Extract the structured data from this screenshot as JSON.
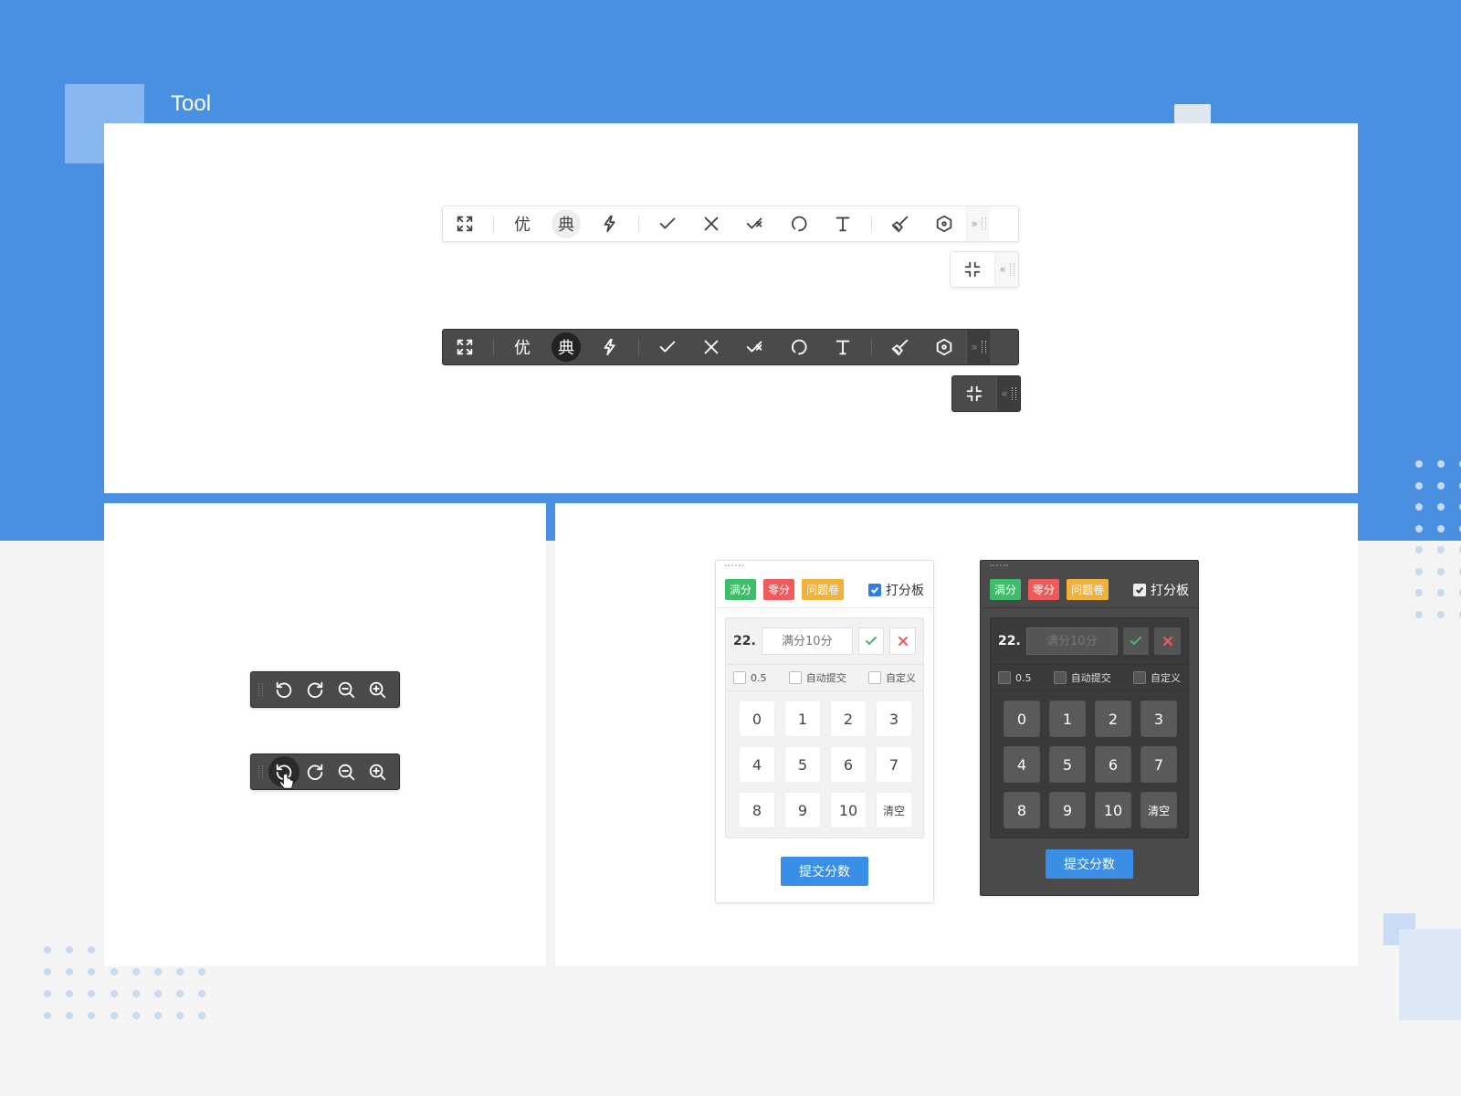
{
  "page": {
    "title": "Tool"
  },
  "toolbar": {
    "label_you": "优",
    "label_dian": "典",
    "collapse_more": "»",
    "collapse_less": "«"
  },
  "scoreboard": {
    "tags": {
      "full": "满分",
      "zero": "零分",
      "problem": "问题卷"
    },
    "panel_toggle": "打分板",
    "question_no": "22.",
    "placeholder": "满分10分",
    "options": {
      "half": "0.5",
      "auto_submit": "自动提交",
      "custom": "自定义"
    },
    "keys": [
      "0",
      "1",
      "2",
      "3",
      "4",
      "5",
      "6",
      "7",
      "8",
      "9",
      "10",
      "清空"
    ],
    "submit": "提交分数"
  },
  "colors": {
    "primary_blue": "#4a90e2",
    "button_blue": "#3a8ee6",
    "tag_green": "#3ebd6a",
    "tag_red": "#f05a5a",
    "tag_yellow": "#f2b13a"
  }
}
